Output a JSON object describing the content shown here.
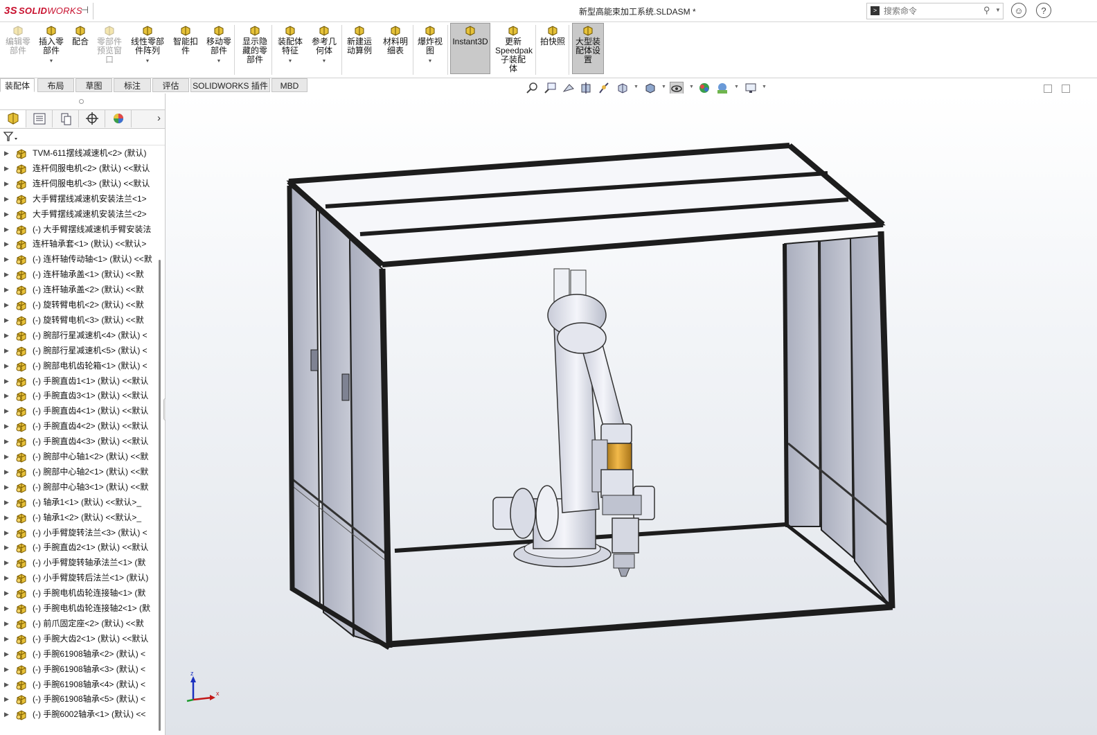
{
  "app": {
    "logo_ds": "3S",
    "logo_solid": "SOLID",
    "logo_works": "WORKS",
    "document_title": "新型高能束加工系统.SLDASM *"
  },
  "search": {
    "placeholder": "搜索命令"
  },
  "ribbon": {
    "buttons": [
      {
        "label": "编辑零\n部件",
        "icon": "edit-component-icon",
        "disabled": true
      },
      {
        "label": "插入零\n部件",
        "icon": "insert-component-icon",
        "disabled": false,
        "dropdown": true
      },
      {
        "label": "配合",
        "icon": "mate-icon",
        "disabled": false
      },
      {
        "label": "零部件\n预览窗\n口",
        "icon": "component-preview-icon",
        "disabled": true
      },
      {
        "label": "线性零部\n件阵列",
        "icon": "linear-pattern-icon",
        "disabled": false,
        "dropdown": true
      },
      {
        "label": "智能扣\n件",
        "icon": "smart-fasteners-icon",
        "disabled": false
      },
      {
        "label": "移动零\n部件",
        "icon": "move-component-icon",
        "disabled": false,
        "dropdown": true
      },
      {
        "label": "显示隐\n藏的零\n部件",
        "icon": "show-hidden-icon",
        "disabled": false
      },
      {
        "label": "装配体\n特征",
        "icon": "assembly-features-icon",
        "disabled": false,
        "dropdown": true
      },
      {
        "label": "参考几\n何体",
        "icon": "reference-geometry-icon",
        "disabled": false,
        "dropdown": true
      },
      {
        "label": "新建运\n动算例",
        "icon": "motion-study-icon",
        "disabled": false
      },
      {
        "label": "材料明\n细表",
        "icon": "bom-icon",
        "disabled": false
      },
      {
        "label": "爆炸视\n图",
        "icon": "exploded-view-icon",
        "disabled": false,
        "dropdown": true
      },
      {
        "label": "Instant3D",
        "icon": "instant3d-icon",
        "disabled": false,
        "active": true
      },
      {
        "label": "更新\nSpeedpak\n子装配\n体",
        "icon": "speedpak-icon",
        "disabled": false
      },
      {
        "label": "拍快照",
        "icon": "snapshot-icon",
        "disabled": false
      },
      {
        "label": "大型装\n配体设\n置",
        "icon": "large-assembly-icon",
        "disabled": false,
        "active": true
      }
    ]
  },
  "tabs": [
    "装配体",
    "布局",
    "草图",
    "标注",
    "评估",
    "SOLIDWORKS 插件",
    "MBD"
  ],
  "active_tab": "装配体",
  "feature_tree": {
    "items": [
      "TVM-611摆线减速机<2> (默认)",
      "连杆伺服电机<2> (默认) <<默认",
      "连杆伺服电机<3> (默认) <<默认",
      "大手臂摆线减速机安装法兰<1>",
      "大手臂摆线减速机安装法兰<2>",
      "(-) 大手臂摆线减速机手臂安装法",
      "连杆轴承套<1> (默认) <<默认>",
      "(-) 连杆轴传动轴<1> (默认) <<默",
      "(-) 连杆轴承盖<1> (默认) <<默",
      "(-) 连杆轴承盖<2> (默认) <<默",
      "(-) 旋转臂电机<2> (默认) <<默",
      "(-) 旋转臂电机<3> (默认) <<默",
      "(-) 腕部行星减速机<4> (默认) <",
      "(-) 腕部行星减速机<5> (默认) <",
      "(-) 腕部电机齿轮箱<1> (默认) <",
      "(-) 手腕直齿1<1> (默认) <<默认",
      "(-) 手腕直齿3<1> (默认) <<默认",
      "(-) 手腕直齿4<1> (默认) <<默认",
      "(-) 手腕直齿4<2> (默认) <<默认",
      "(-) 手腕直齿4<3> (默认) <<默认",
      "(-) 腕部中心轴1<2> (默认) <<默",
      "(-) 腕部中心轴2<1> (默认) <<默",
      "(-) 腕部中心轴3<1> (默认) <<默",
      "(-) 轴承1<1> (默认) <<默认>_",
      "(-) 轴承1<2> (默认) <<默认>_",
      "(-) 小手臂旋转法兰<3> (默认) <",
      "(-) 手腕直齿2<1> (默认) <<默认",
      "(-) 小手臂旋转轴承法兰<1> (默",
      "(-) 小手臂旋转后法兰<1> (默认)",
      "(-) 手腕电机齿轮连接轴<1> (默",
      "(-) 手腕电机齿轮连接轴2<1> (默",
      "(-) 前爪固定座<2> (默认) <<默",
      "(-) 手腕大齿2<1> (默认) <<默认",
      "(-) 手腕61908轴承<2> (默认) <",
      "(-) 手腕61908轴承<3> (默认) <",
      "(-) 手腕61908轴承<4> (默认) <",
      "(-) 手腕61908轴承<5> (默认) <",
      "(-) 手腕6002轴承<1> (默认) <<"
    ]
  },
  "triad": {
    "x": "x",
    "z": "z"
  },
  "colors": {
    "accent": "#c8102e",
    "part_icon": "#e8c23a",
    "frame": "#2a2a2a",
    "glass": "#c5c9d6"
  }
}
